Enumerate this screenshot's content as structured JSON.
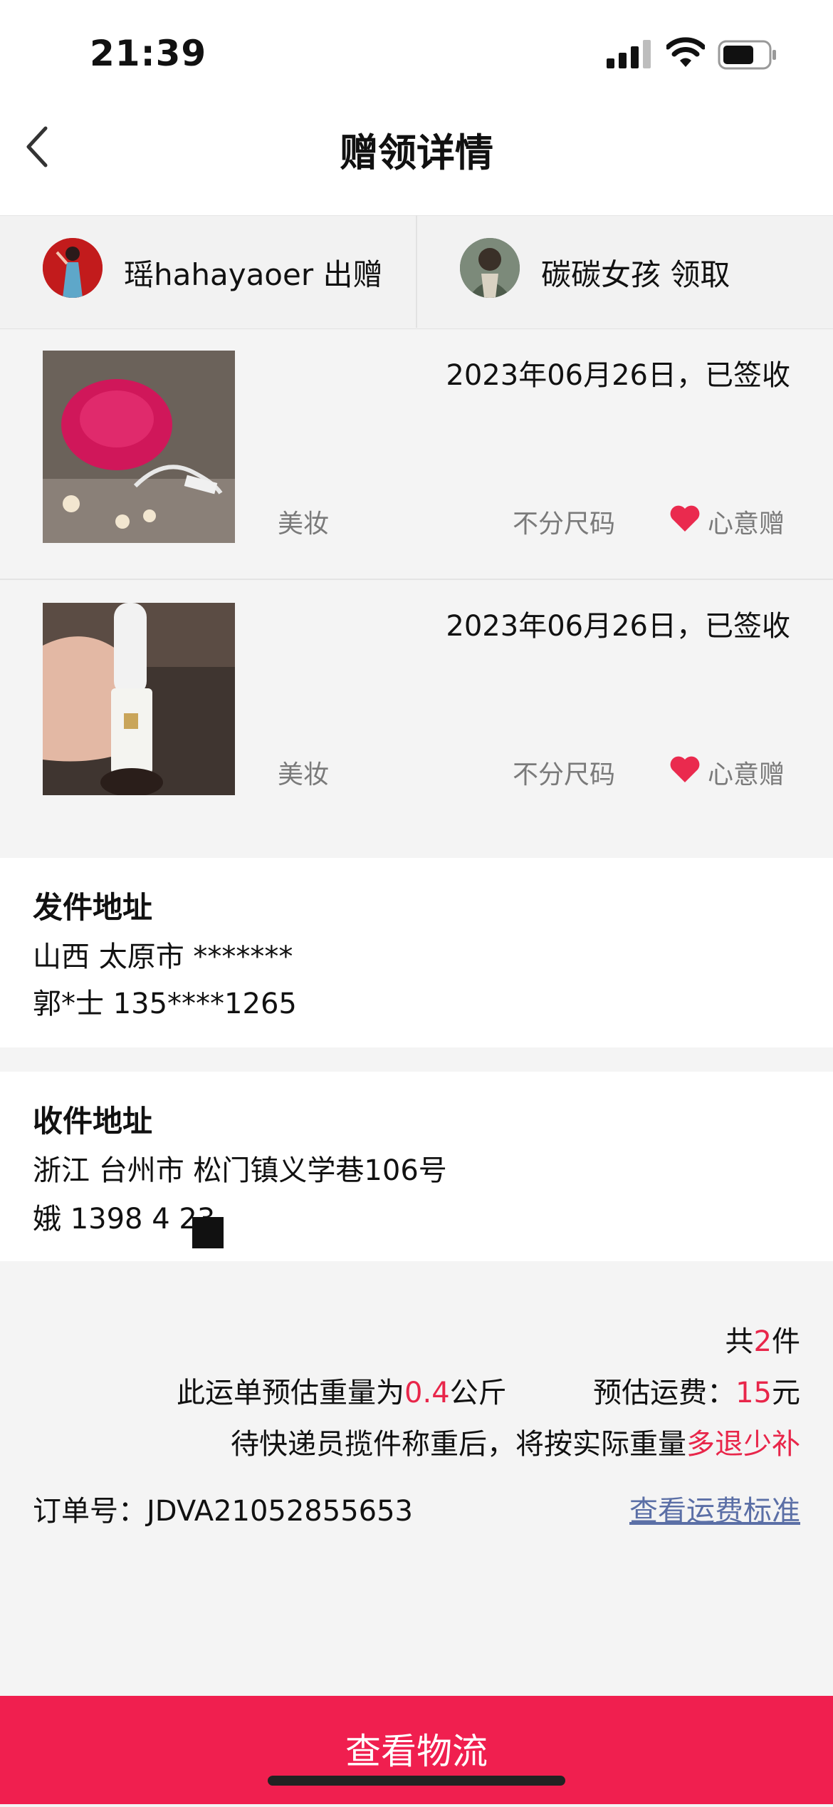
{
  "status_bar": {
    "time": "21:39"
  },
  "nav": {
    "title": "赠领详情",
    "back_icon": "chevron-left-icon"
  },
  "parties": {
    "giver": {
      "name": "瑶hahayaoer",
      "action": "出赠"
    },
    "receiver": {
      "name": "碳碳女孩",
      "action": "领取"
    }
  },
  "items": [
    {
      "date_status": "2023年06月26日，已签收",
      "category": "美妆",
      "size": "不分尺码",
      "type": "心意赠"
    },
    {
      "date_status": "2023年06月26日，已签收",
      "category": "美妆",
      "size": "不分尺码",
      "type": "心意赠"
    }
  ],
  "sender": {
    "title": "发件地址",
    "address": "山西 太原市 *******",
    "contact": "郭*士 135****1265"
  },
  "receiver_address": {
    "title": "收件地址",
    "address": "浙江 台州市 松门镇义学巷106号",
    "contact": "娥 1398  4  23"
  },
  "summary": {
    "count_prefix": "共",
    "count": "2",
    "count_suffix": "件",
    "weight_prefix": "此运单预估重量为",
    "weight": "0.4",
    "weight_suffix": "公斤",
    "fee_prefix": "预估运费：",
    "fee": "15",
    "fee_suffix": "元",
    "note_prefix": "待快递员揽件称重后，将按实际重量",
    "note_highlight": "多退少补",
    "order_label": "订单号：",
    "order_no": "JDVA21052855653",
    "fee_link": "查看运费标准"
  },
  "bottom": {
    "button_label": "查看物流"
  },
  "colors": {
    "accent": "#f01f4f",
    "highlight": "#e8264a",
    "link": "#5b6fa6"
  }
}
